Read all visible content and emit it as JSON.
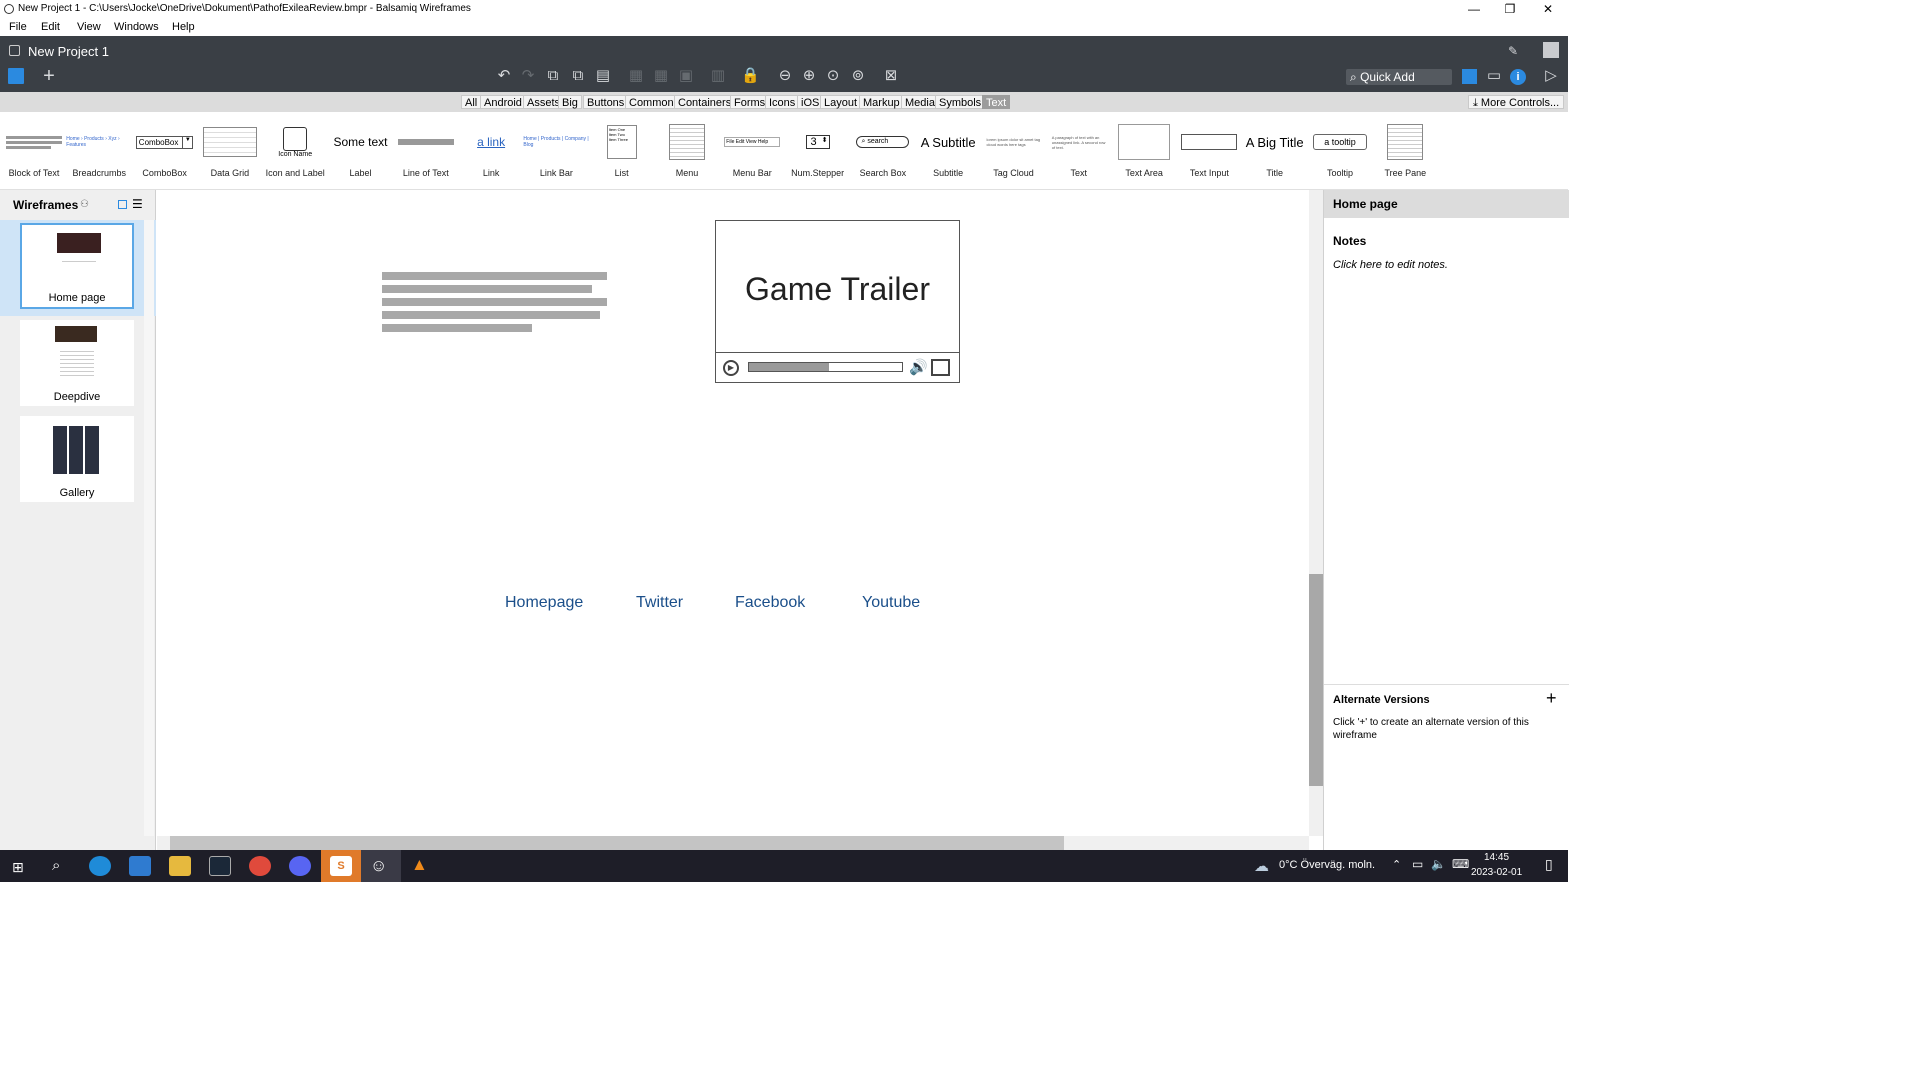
{
  "window": {
    "title": "New Project 1 - C:\\Users\\Jocke\\OneDrive\\Dokument\\PathofExileaReview.bmpr - Balsamiq Wireframes",
    "minimize": "—",
    "maximize": "❐",
    "close": "✕"
  },
  "menu": {
    "file": "File",
    "edit": "Edit",
    "view": "View",
    "windows": "Windows",
    "help": "Help"
  },
  "header": {
    "project_title": "New Project 1",
    "quick_add": "Quick Add"
  },
  "categories": [
    "All",
    "Android",
    "Assets",
    "Big",
    "Buttons",
    "Common",
    "Containers",
    "Forms",
    "Icons",
    "iOS",
    "Layout",
    "Markup",
    "Media",
    "Symbols",
    "Text"
  ],
  "selected_category": "Text",
  "more_controls": "More Controls...",
  "palette": [
    {
      "label": "Block of Text"
    },
    {
      "label": "Breadcrumbs"
    },
    {
      "label": "ComboBox",
      "preview": "ComboBox"
    },
    {
      "label": "Data Grid"
    },
    {
      "label": "Icon and Label",
      "preview": "Icon Name"
    },
    {
      "label": "Label",
      "preview": "Some text"
    },
    {
      "label": "Line of Text"
    },
    {
      "label": "Link",
      "preview": "a link"
    },
    {
      "label": "Link Bar"
    },
    {
      "label": "List"
    },
    {
      "label": "Menu"
    },
    {
      "label": "Menu Bar"
    },
    {
      "label": "Num.Stepper",
      "preview": "3"
    },
    {
      "label": "Search Box",
      "preview": "search"
    },
    {
      "label": "Subtitle",
      "preview": "A Subtitle"
    },
    {
      "label": "Tag Cloud"
    },
    {
      "label": "Text"
    },
    {
      "label": "Text Area"
    },
    {
      "label": "Text Input"
    },
    {
      "label": "Title",
      "preview": "A Big Title"
    },
    {
      "label": "Tooltip",
      "preview": "a tooltip"
    },
    {
      "label": "Tree Pane"
    }
  ],
  "wireframes": {
    "header": "Wireframes",
    "items": [
      {
        "label": "Home page",
        "selected": true
      },
      {
        "label": "Deepdive",
        "selected": false
      },
      {
        "label": "Gallery",
        "selected": false
      }
    ]
  },
  "canvas": {
    "video_title": "Game Trailer",
    "video_progress": 0.52,
    "links": [
      "Homepage",
      "Twitter",
      "Facebook",
      "Youtube"
    ]
  },
  "right_panel": {
    "page_name": "Home page",
    "notes_heading": "Notes",
    "notes_placeholder": "Click here to edit notes.",
    "alt_heading": "Alternate Versions",
    "alt_text": "Click '+' to create an alternate version of this wireframe",
    "alt_add": "+"
  },
  "taskbar": {
    "weather": "0°C  Överväg. moln.",
    "time": "14:45",
    "date": "2023-02-01"
  },
  "colors": {
    "accent": "#1b4f8a",
    "header": "#3a3f45",
    "selection": "#5aa7e6"
  }
}
